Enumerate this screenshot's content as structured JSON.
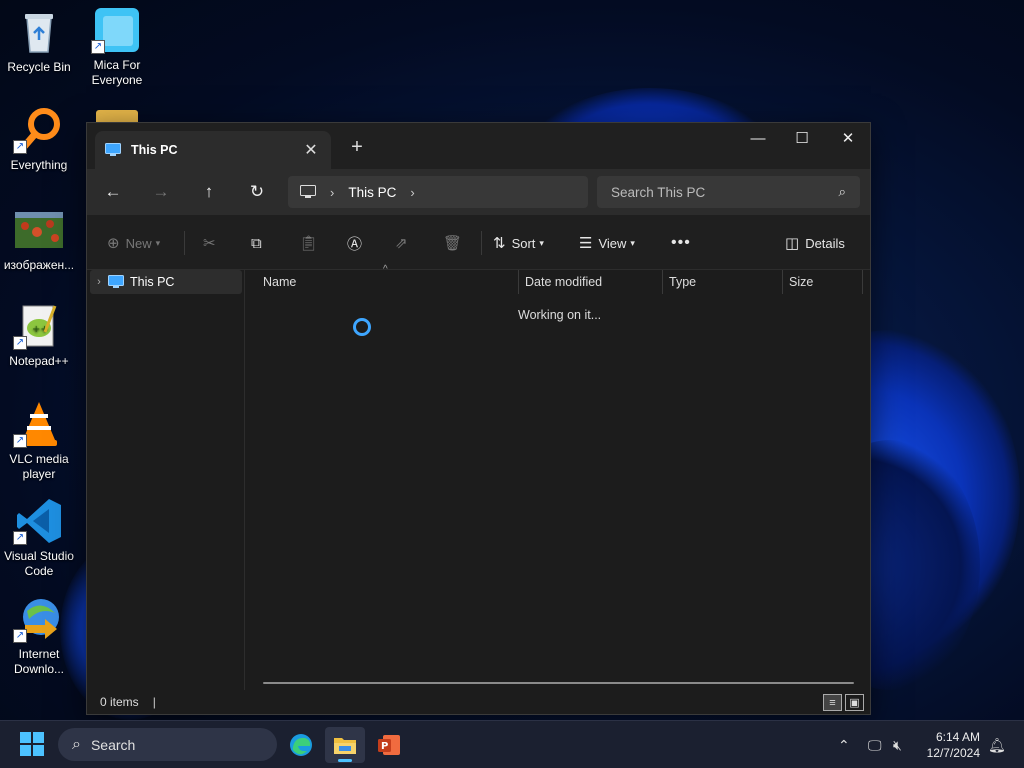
{
  "desktop": {
    "icons": [
      {
        "label": "Recycle Bin",
        "icon": "recycle-bin-icon"
      },
      {
        "label": "Mica For Everyone",
        "icon": "mica-icon"
      },
      {
        "label": "Everything",
        "icon": "everything-search-icon"
      },
      {
        "label": "изображен...",
        "icon": "image-file-icon"
      },
      {
        "label": "Notepad++",
        "icon": "notepad-plus-plus-icon"
      },
      {
        "label": "VLC media player",
        "icon": "vlc-icon"
      },
      {
        "label": "Visual Studio Code",
        "icon": "vscode-icon"
      },
      {
        "label": "Internet Downlo...",
        "icon": "internet-download-manager-icon"
      }
    ]
  },
  "explorer": {
    "tab_title": "This PC",
    "new_tab_symbol": "+",
    "address": {
      "segment": "This PC"
    },
    "search_placeholder": "Search This PC",
    "toolbar": {
      "new_label": "New",
      "sort_label": "Sort",
      "view_label": "View",
      "details_label": "Details"
    },
    "sidebar": {
      "items": [
        {
          "label": "This PC"
        }
      ]
    },
    "columns": [
      "Name",
      "Date modified",
      "Type",
      "Size"
    ],
    "status_message": "Working on it...",
    "status_bar": {
      "item_count": "0 items"
    }
  },
  "taskbar": {
    "search_label": "Search",
    "time": "6:14 AM",
    "date": "12/7/2024"
  },
  "colors": {
    "accent": "#4cc2ff",
    "spinner": "#3ea6ff",
    "window_bg": "#1c1c1c"
  }
}
